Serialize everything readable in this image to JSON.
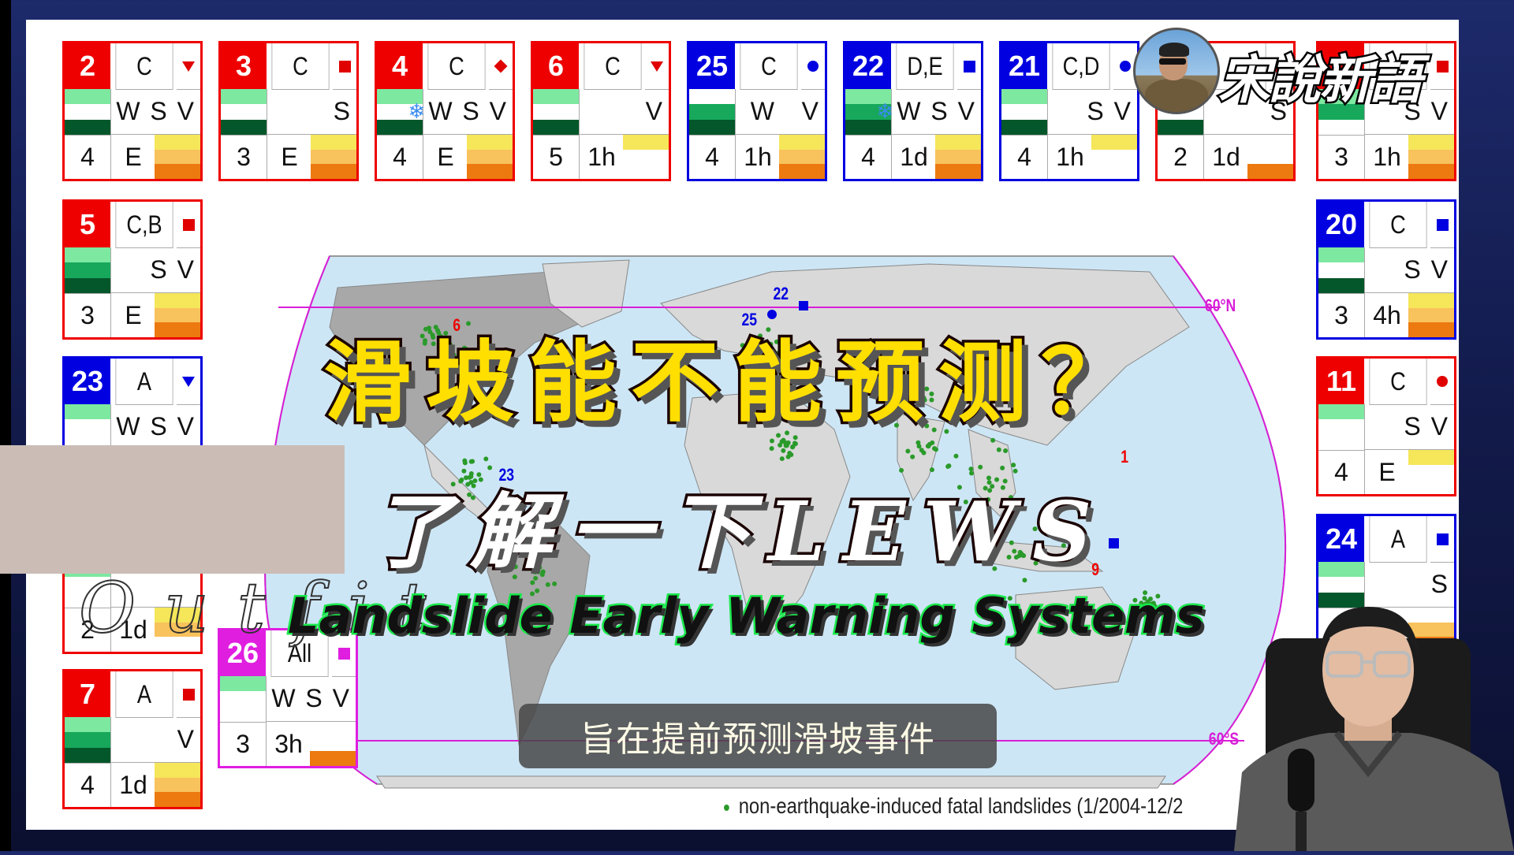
{
  "slide": {
    "legend_text": "non-earthquake-induced fatal landslides (1/2004-12/2",
    "map_labels": {
      "lat_north": "60°N",
      "lat_south": "60°S",
      "markers": [
        {
          "id": "6",
          "shape": "triangle",
          "color": "#e00000"
        },
        {
          "id": "22",
          "shape": "square",
          "color": "#0000e0"
        },
        {
          "id": "25",
          "shape": "circle",
          "color": "#0000e0"
        },
        {
          "id": "23",
          "shape": "triangle",
          "color": "#0000e0"
        },
        {
          "id": "1",
          "shape": "triangle",
          "color": "#e00000"
        },
        {
          "id": "9",
          "shape": "square",
          "color": "#0000e0"
        }
      ]
    },
    "colors": {
      "regional_border": "#e00000",
      "local_border": "#0000e0",
      "global_border": "#e01ee0",
      "green_light": "#7de8a0",
      "green_mid": "#17a85c",
      "green_dark": "#03572a",
      "thr_yellow": "#f5e65a",
      "thr_light_orange": "#f8c25c",
      "thr_orange": "#ec7a10",
      "ocean": "#cde6f5",
      "land": "#d9d9d9",
      "land_dark": "#a8a8a8",
      "landslide_dot": "#2a9a2a",
      "latitude_line": "#d81ed8"
    },
    "cards": [
      {
        "num": "2",
        "scale": "regional",
        "cls": "C",
        "symbol": "triangle",
        "bars": [
          "light",
          "white",
          "dark"
        ],
        "snow": false,
        "vars": "W S V",
        "level": "4",
        "lead": "E",
        "thr": [
          "yellow",
          "light_orange",
          "orange"
        ]
      },
      {
        "num": "3",
        "scale": "regional",
        "cls": "C",
        "symbol": "square",
        "bars": [
          "light",
          "white",
          "dark"
        ],
        "snow": false,
        "vars": "S",
        "level": "3",
        "lead": "E",
        "thr": [
          "yellow",
          "light_orange",
          "orange"
        ]
      },
      {
        "num": "4",
        "scale": "regional",
        "cls": "C",
        "symbol": "diamond",
        "bars": [
          "light",
          "white",
          "dark"
        ],
        "snow": true,
        "vars": "W S V",
        "level": "4",
        "lead": "E",
        "thr": [
          "yellow",
          "light_orange",
          "orange"
        ]
      },
      {
        "num": "6",
        "scale": "regional",
        "cls": "C",
        "symbol": "triangle",
        "bars": [
          "light",
          "white",
          "dark"
        ],
        "snow": false,
        "vars": "V",
        "level": "5",
        "lead": "1h",
        "thr": [
          "yellow",
          "white",
          "white"
        ]
      },
      {
        "num": "25",
        "scale": "local",
        "cls": "C",
        "symbol": "circle",
        "bars": [
          "white",
          "mid",
          "dark"
        ],
        "snow": false,
        "vars": "W   V",
        "level": "4",
        "lead": "1h",
        "thr": [
          "yellow",
          "light_orange",
          "orange"
        ]
      },
      {
        "num": "22",
        "scale": "local",
        "cls": "D,E",
        "symbol": "square",
        "bars": [
          "light",
          "mid",
          "dark"
        ],
        "snow": true,
        "vars": "W S V",
        "level": "4",
        "lead": "1d",
        "thr": [
          "yellow",
          "light_orange",
          "orange"
        ]
      },
      {
        "num": "21",
        "scale": "local",
        "cls": "C,D",
        "symbol": "circle",
        "bars": [
          "light",
          "white",
          "dark"
        ],
        "snow": false,
        "vars": "S V",
        "level": "4",
        "lead": "1h",
        "thr": [
          "yellow",
          "white",
          "white"
        ]
      },
      {
        "num": "",
        "scale": "regional",
        "cls": "",
        "symbol": "square",
        "bars": [
          "white",
          "white",
          "dark"
        ],
        "snow": false,
        "vars": "S",
        "level": "2",
        "lead": "1d",
        "thr": [
          "white",
          "white",
          "orange"
        ]
      },
      {
        "num": "",
        "scale": "regional",
        "cls": "",
        "symbol": "square",
        "bars": [
          "light",
          "mid",
          "white"
        ],
        "snow": false,
        "vars": "S V",
        "level": "3",
        "lead": "1h",
        "thr": [
          "yellow",
          "light_orange",
          "orange"
        ]
      },
      {
        "num": "5",
        "scale": "regional",
        "cls": "C,B",
        "symbol": "square",
        "bars": [
          "light",
          "mid",
          "dark"
        ],
        "snow": false,
        "vars": "S V",
        "level": "3",
        "lead": "E",
        "thr": [
          "yellow",
          "light_orange",
          "orange"
        ]
      },
      {
        "num": "23",
        "scale": "local",
        "cls": "A",
        "symbol": "triangle",
        "bars": [
          "light",
          "white",
          "white"
        ],
        "snow": false,
        "vars": "W S V",
        "level": "",
        "lead": "",
        "thr": [
          "white",
          "white",
          "white"
        ]
      },
      {
        "num": "",
        "scale": "regional",
        "cls": "",
        "symbol": "none",
        "bars": [
          "light",
          "white",
          "white"
        ],
        "snow": false,
        "vars": "",
        "level": "2",
        "lead": "1d",
        "thr": [
          "yellow",
          "light_orange",
          "white"
        ]
      },
      {
        "num": "7",
        "scale": "regional",
        "cls": "A",
        "symbol": "square",
        "bars": [
          "light",
          "mid",
          "dark"
        ],
        "snow": false,
        "vars": "V",
        "level": "4",
        "lead": "1d",
        "thr": [
          "yellow",
          "light_orange",
          "orange"
        ]
      },
      {
        "num": "26",
        "scale": "global",
        "cls": "All",
        "symbol": "square",
        "bars": [
          "light",
          "white",
          "white"
        ],
        "snow": false,
        "vars": "W S V",
        "level": "3",
        "lead": "3h",
        "thr": [
          "white",
          "white",
          "orange"
        ]
      },
      {
        "num": "20",
        "scale": "local",
        "cls": "C",
        "symbol": "square",
        "bars": [
          "light",
          "white",
          "dark"
        ],
        "snow": false,
        "vars": "S V",
        "level": "3",
        "lead": "4h",
        "thr": [
          "yellow",
          "light_orange",
          "orange"
        ]
      },
      {
        "num": "11",
        "scale": "regional",
        "cls": "C",
        "symbol": "circle",
        "bars": [
          "light",
          "white",
          "white"
        ],
        "snow": false,
        "vars": "S V",
        "level": "4",
        "lead": "E",
        "thr": [
          "yellow",
          "white",
          "white"
        ]
      },
      {
        "num": "24",
        "scale": "local",
        "cls": "A",
        "symbol": "square",
        "bars": [
          "light",
          "white",
          "dark"
        ],
        "snow": false,
        "vars": "S",
        "level": "",
        "lead": "",
        "thr": [
          "white",
          "light_orange",
          "orange"
        ]
      }
    ]
  },
  "overlay": {
    "title_main": "滑坡能不能预测？",
    "title_sub": "了解一下LEWS",
    "title_english": "Landslide Early Warning Systems",
    "ghost_text": "Outfit",
    "subtitle": "旨在提前预测滑坡事件",
    "brand": "宋說新語",
    "avatar": "channel-avatar"
  }
}
